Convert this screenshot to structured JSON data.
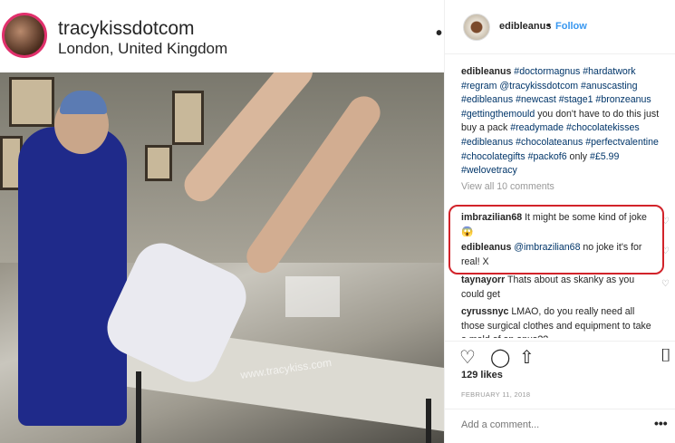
{
  "original_post": {
    "username": "tracykissdotcom",
    "location": "London, United Kingdom",
    "more_glyph": "•",
    "watermark": "www.tracykiss.com"
  },
  "post": {
    "username": "edibleanus",
    "separator": "•",
    "follow_label": "Follow",
    "caption_parts": [
      {
        "text": "edibleanus",
        "type": "user"
      },
      {
        "text": " ",
        "type": "plain"
      },
      {
        "text": "#doctormagnus #hardatwork #regram @tracykissdotcom #anuscasting #edibleanus #newcast #stage1 #bronzeanus #gettingthemould",
        "type": "tag"
      },
      {
        "text": " you don't have to do this just buy a pack ",
        "type": "plain"
      },
      {
        "text": "#readymade #chocolatekisses #edibleanus #chocolateanus #perfectvalentine #chocolategifts #packof6",
        "type": "tag"
      },
      {
        "text": " only ",
        "type": "plain"
      },
      {
        "text": "#£5.99 #welovetracy",
        "type": "tag"
      }
    ],
    "view_all_label": "View all 10 comments",
    "comments": [
      {
        "user": "imbrazilian68",
        "text": " It might be some kind of joke😱"
      },
      {
        "user": "edibleanus",
        "text_mention": "@imbrazilian68",
        "text": " no joke it's for real! X"
      },
      {
        "user": "taynayorr",
        "text": " Thats about as skanky as you could get"
      },
      {
        "user": "cyrussnyc",
        "text": " LMAO, do you really need all those surgical clothes and equipment to take a mold of an anus??"
      }
    ],
    "likes_label": "129 likes",
    "date_label": "FEBRUARY 11, 2018",
    "add_comment_placeholder": "Add a comment...",
    "more_options_glyph": "•••"
  },
  "icons": {
    "heart": "♡",
    "comment": "◯",
    "share": "⇧",
    "save": "⌷"
  },
  "colors": {
    "link": "#3897f0",
    "tag": "#003569",
    "highlight": "#d2232a"
  }
}
